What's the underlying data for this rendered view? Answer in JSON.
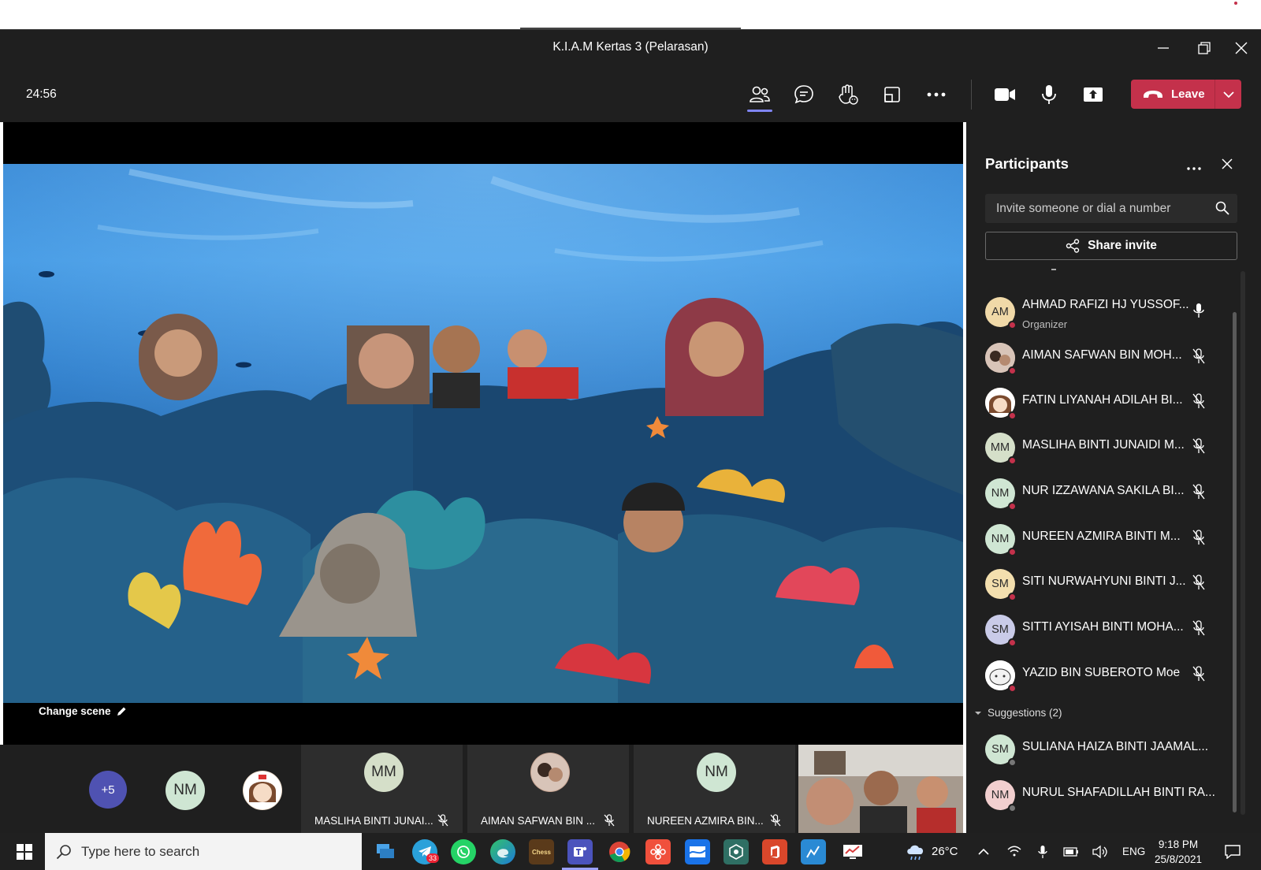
{
  "window": {
    "title": "K.I.A.M Kertas 3 (Pelarasan)"
  },
  "toolbar": {
    "timer": "24:56",
    "leave_label": "Leave"
  },
  "stage": {
    "change_scene_label": "Change scene"
  },
  "gallery": {
    "overflow_badge": "+5",
    "avatars": [
      {
        "initials": "NM"
      }
    ],
    "tiles": [
      {
        "initials": "MM",
        "name": "MASLIHA BINTI JUNAI...",
        "muted": true
      },
      {
        "initials": "",
        "name": "AIMAN SAFWAN BIN ...",
        "muted": true
      },
      {
        "initials": "NM",
        "name": "NUREEN AZMIRA BIN...",
        "muted": true
      }
    ]
  },
  "panel": {
    "title": "Participants",
    "invite_placeholder": "Invite someone or dial a number",
    "share_label": "Share invite",
    "participants": [
      {
        "initials": "AM",
        "name": "AHMAD RAFIZI HJ YUSSOF...",
        "role": "Organizer",
        "avatar_color": "#f0d9a8",
        "mic": "on"
      },
      {
        "initials": "",
        "name": "AIMAN SAFWAN BIN MOH...",
        "avatar_color": "#c9a795",
        "mic": "muted"
      },
      {
        "initials": "",
        "name": "FATIN LIYANAH ADILAH BI...",
        "avatar_color": "#d8b08c",
        "mic": "muted"
      },
      {
        "initials": "MM",
        "name": "MASLIHA BINTI JUNAIDI M...",
        "avatar_color": "#d5dfc9",
        "mic": "muted"
      },
      {
        "initials": "NM",
        "name": "NUR IZZAWANA SAKILA BI...",
        "avatar_color": "#cfe6d3",
        "mic": "muted"
      },
      {
        "initials": "NM",
        "name": "NUREEN AZMIRA BINTI M...",
        "avatar_color": "#cfe6d3",
        "mic": "muted"
      },
      {
        "initials": "SM",
        "name": "SITI NURWAHYUNI BINTI J...",
        "avatar_color": "#f3dfae",
        "mic": "muted"
      },
      {
        "initials": "SM",
        "name": "SITTI AYISAH BINTI MOHA...",
        "avatar_color": "#c9cbe8",
        "mic": "muted"
      },
      {
        "initials": "",
        "name": "YAZID BIN SUBEROTO Moe",
        "avatar_color": "#f4f4f4",
        "mic": "muted"
      }
    ],
    "suggestions_label": "Suggestions (2)",
    "suggestions": [
      {
        "initials": "SM",
        "name": "SULIANA HAIZA BINTI JAAMAL...",
        "avatar_color": "#cfe6d3"
      },
      {
        "initials": "NM",
        "name": "NURUL SHAFADILLAH BINTI RA...",
        "avatar_color": "#f2cfcf"
      }
    ]
  },
  "taskbar": {
    "search_placeholder": "Type here to search",
    "telegram_badge": "33",
    "chess_label": "Chess",
    "temperature": "26°C",
    "language": "ENG",
    "time": "9:18 PM",
    "date": "25/8/2021"
  },
  "colors": {
    "leave": "#c4314b",
    "accent": "#7f85f5",
    "panel_bg": "#1f1f1f"
  }
}
